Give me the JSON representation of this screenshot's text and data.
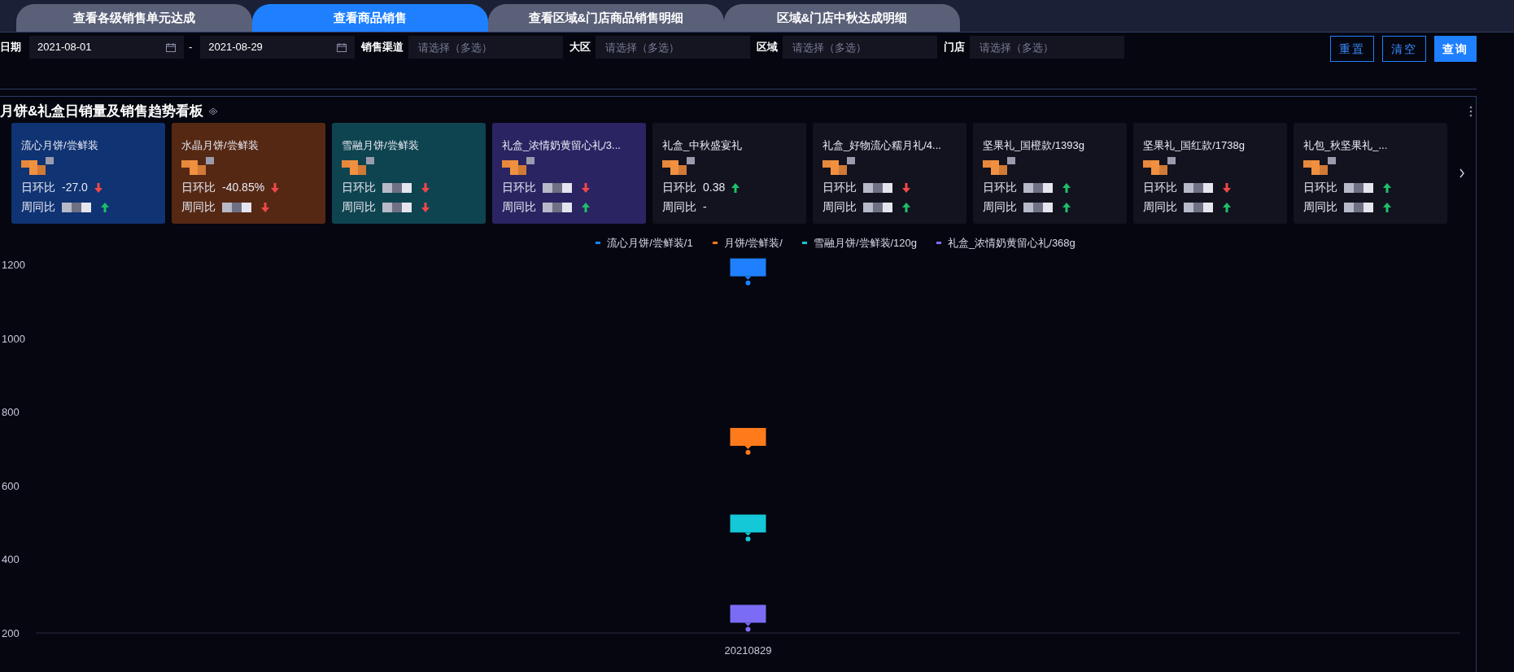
{
  "tabs": [
    {
      "label": "查看各级销售单元达成",
      "selected": false
    },
    {
      "label": "查看商品销售",
      "selected": true
    },
    {
      "label": "查看区域&门店商品销售明细",
      "selected": false
    },
    {
      "label": "区域&门店中秋达成明细",
      "selected": false
    }
  ],
  "filters": {
    "date_label": "日期",
    "date_start": "2021-08-01",
    "date_sep": "-",
    "date_end": "2021-08-29",
    "selects": [
      {
        "label": "销售渠道",
        "placeholder": "请选择（多选）"
      },
      {
        "label": "大区",
        "placeholder": "请选择（多选）"
      },
      {
        "label": "区域",
        "placeholder": "请选择（多选）"
      },
      {
        "label": "门店",
        "placeholder": "请选择（多选）"
      }
    ],
    "buttons": [
      {
        "label": "重置",
        "kind": "outline"
      },
      {
        "label": "清空",
        "kind": "outline"
      },
      {
        "label": "查询",
        "kind": "primary"
      }
    ]
  },
  "panel": {
    "title": "月饼&礼盒日销量及销售趋势看板",
    "cards": [
      {
        "name": "流心月饼/尝鲜装",
        "color": "#0f3373",
        "daily_label": "日环比",
        "daily_value": "-27.0",
        "daily_rising": false,
        "weekly_label": "周同比",
        "weekly_rising": true
      },
      {
        "name": "水晶月饼/尝鲜装",
        "color": "#552814",
        "daily_label": "日环比",
        "daily_value": "-40.85%",
        "daily_rising": false,
        "weekly_label": "周同比",
        "weekly_rising": false
      },
      {
        "name": "雪融月饼/尝鲜装",
        "color": "#0e4450",
        "daily_label": "日环比",
        "daily_rising": false,
        "weekly_label": "周同比",
        "weekly_rising": false
      },
      {
        "name": "礼盒_浓情奶黄留心礼/3...",
        "color": "#2a2462",
        "daily_label": "日环比",
        "daily_rising": false,
        "weekly_label": "周同比",
        "weekly_rising": true
      },
      {
        "name": "礼盒_中秋盛宴礼",
        "daily_label": "日环比",
        "daily_value": "0.38",
        "daily_rising": true,
        "weekly_label": "周同比",
        "weekly_value": "-"
      },
      {
        "name": "礼盒_好物流心糯月礼/4...",
        "daily_label": "日环比",
        "daily_rising": false,
        "weekly_label": "周同比",
        "weekly_rising": true
      },
      {
        "name": "坚果礼_国橙款/1393g",
        "daily_label": "日环比",
        "daily_rising": true,
        "weekly_label": "周同比",
        "weekly_rising": true
      },
      {
        "name": "坚果礼_国红款/1738g",
        "daily_label": "日环比",
        "daily_rising": false,
        "weekly_label": "周同比",
        "weekly_rising": true
      },
      {
        "name": "礼包_秋坚果礼_...",
        "daily_label": "日环比",
        "daily_rising": true,
        "weekly_label": "周同比",
        "weekly_rising": true
      }
    ],
    "chart_data": {
      "type": "line",
      "categories": [
        "20210829"
      ],
      "ylim": [
        200,
        1200
      ],
      "yticks": [
        200,
        400,
        600,
        800,
        1000,
        1200
      ],
      "series": [
        {
          "name": "流心月饼/尝鲜装/1",
          "color": "#1e80ff",
          "marker": "circle",
          "values": [
            1150
          ]
        },
        {
          "name": "月饼/尝鲜装/",
          "color": "#ff7a1a",
          "marker": "circle",
          "values": [
            690
          ]
        },
        {
          "name": "雪融月饼/尝鲜装/120g",
          "color": "#14c8d8",
          "marker": "circle",
          "values": [
            455
          ]
        },
        {
          "name": "礼盒_浓情奶黄留心礼/368g",
          "color": "#7b6cf6",
          "marker": "circle",
          "values": [
            210
          ]
        }
      ]
    }
  }
}
